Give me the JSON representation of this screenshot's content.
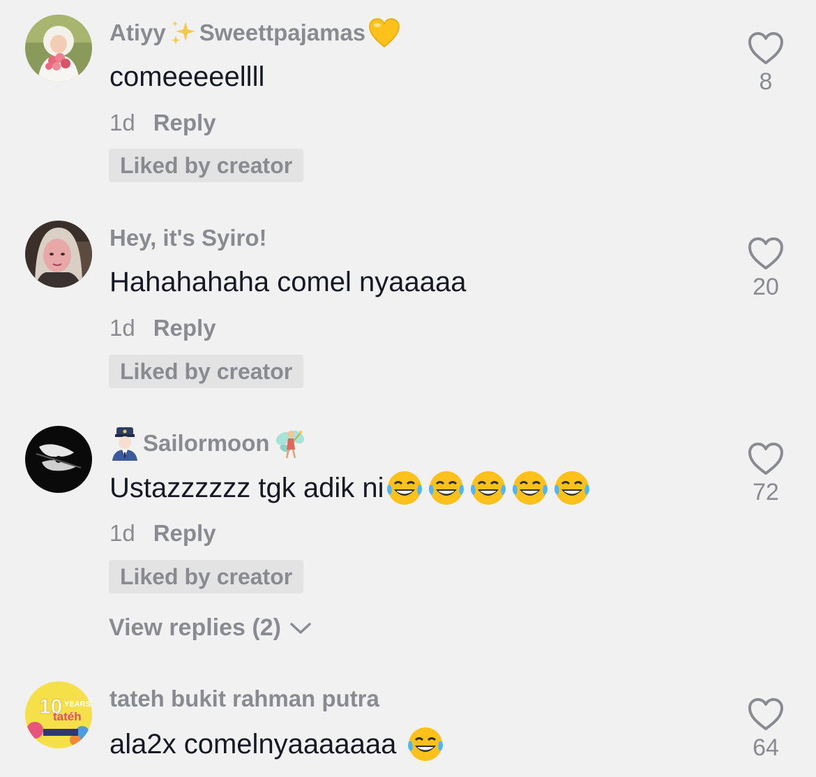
{
  "comments": [
    {
      "username": "Atiyy",
      "username_suffix": "Sweettpajamas",
      "text": "comeeeeellll",
      "time": "1d",
      "reply_label": "Reply",
      "liked_label": "Liked by creator",
      "likes": "8"
    },
    {
      "username": "Hey, it's Syiro!",
      "text": "Hahahahaha comel nyaaaaa",
      "time": "1d",
      "reply_label": "Reply",
      "liked_label": "Liked by creator",
      "likes": "20"
    },
    {
      "username": "Sailormoon",
      "text": "Ustazzzzzz tgk adik ni",
      "time": "1d",
      "reply_label": "Reply",
      "liked_label": "Liked by creator",
      "likes": "72",
      "view_replies": "View replies (2)"
    },
    {
      "username": "tateh bukit rahman putra",
      "text": "ala2x comelnyaaaaaaa",
      "likes": "64",
      "avatar_text": "tatéh"
    }
  ],
  "icons": {
    "like": "heart-outline-icon",
    "sparkles": "sparkles-emoji",
    "yellow_heart": "yellow-heart-emoji",
    "police_officer": "police-officer-emoji",
    "fairy": "fairy-emoji",
    "laughing": "tears-of-joy-emoji",
    "chevron": "chevron-down-icon"
  },
  "colors": {
    "background": "#f1f1f2",
    "primary_text": "#161823",
    "secondary_text": "#8a8b91",
    "badge_bg": "#e3e3e4"
  }
}
